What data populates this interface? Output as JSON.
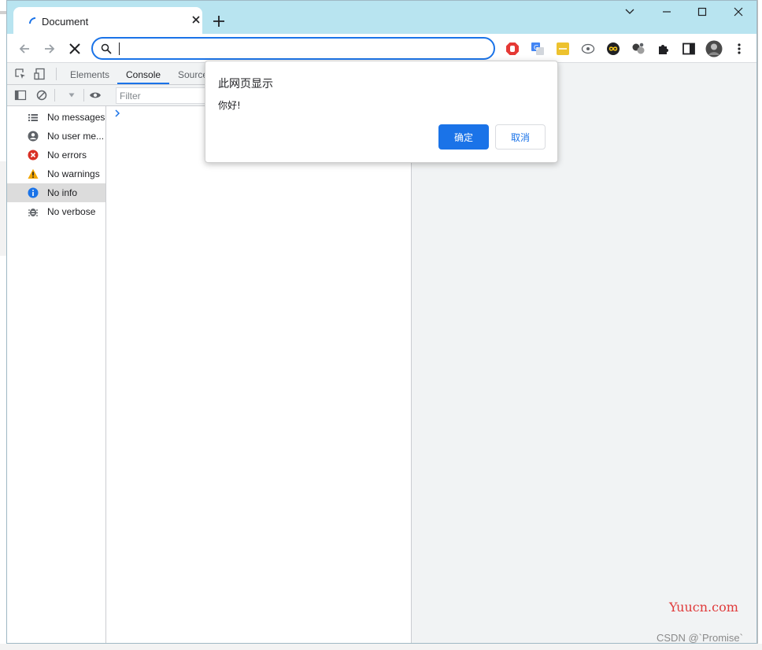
{
  "browser": {
    "tab_title": "Document",
    "new_tab_icon": "plus-icon",
    "window_controls": [
      "chevron-down-icon",
      "minimize-icon",
      "maximize-icon",
      "close-icon"
    ],
    "address_value": "",
    "nav_icons": [
      "back-arrow-icon",
      "forward-arrow-icon",
      "stop-loading-icon"
    ],
    "extension_icons": [
      "adblock-icon",
      "translate-icon",
      "2048-icon",
      "eye-icon",
      "infinity-icon",
      "molecule-icon",
      "puzzle-icon",
      "sidepanel-icon",
      "avatar",
      "more-vert-icon"
    ],
    "accent": "#1a73e8",
    "titlebar_color": "#b8e4f0"
  },
  "devtools": {
    "tabs": [
      {
        "label": "Elements",
        "active": false
      },
      {
        "label": "Console",
        "active": true
      },
      {
        "label": "Source",
        "active": false
      }
    ],
    "filter_placeholder": "Filter",
    "sidebar": [
      {
        "icon": "list-icon",
        "label": "No messages"
      },
      {
        "icon": "user-icon",
        "label": "No user me..."
      },
      {
        "icon": "error-icon",
        "label": "No errors",
        "color": "#d93025"
      },
      {
        "icon": "warning-icon",
        "label": "No warnings",
        "color": "#f2a600"
      },
      {
        "icon": "info-icon",
        "label": "No info",
        "color": "#1a73e8",
        "selected": true
      },
      {
        "icon": "bug-icon",
        "label": "No verbose"
      }
    ]
  },
  "dialog": {
    "title": "此网页显示",
    "message": "你好!",
    "ok_label": "确定",
    "cancel_label": "取消"
  },
  "watermarks": {
    "site": "Yuucn.com",
    "author": "CSDN @`Promise`"
  }
}
